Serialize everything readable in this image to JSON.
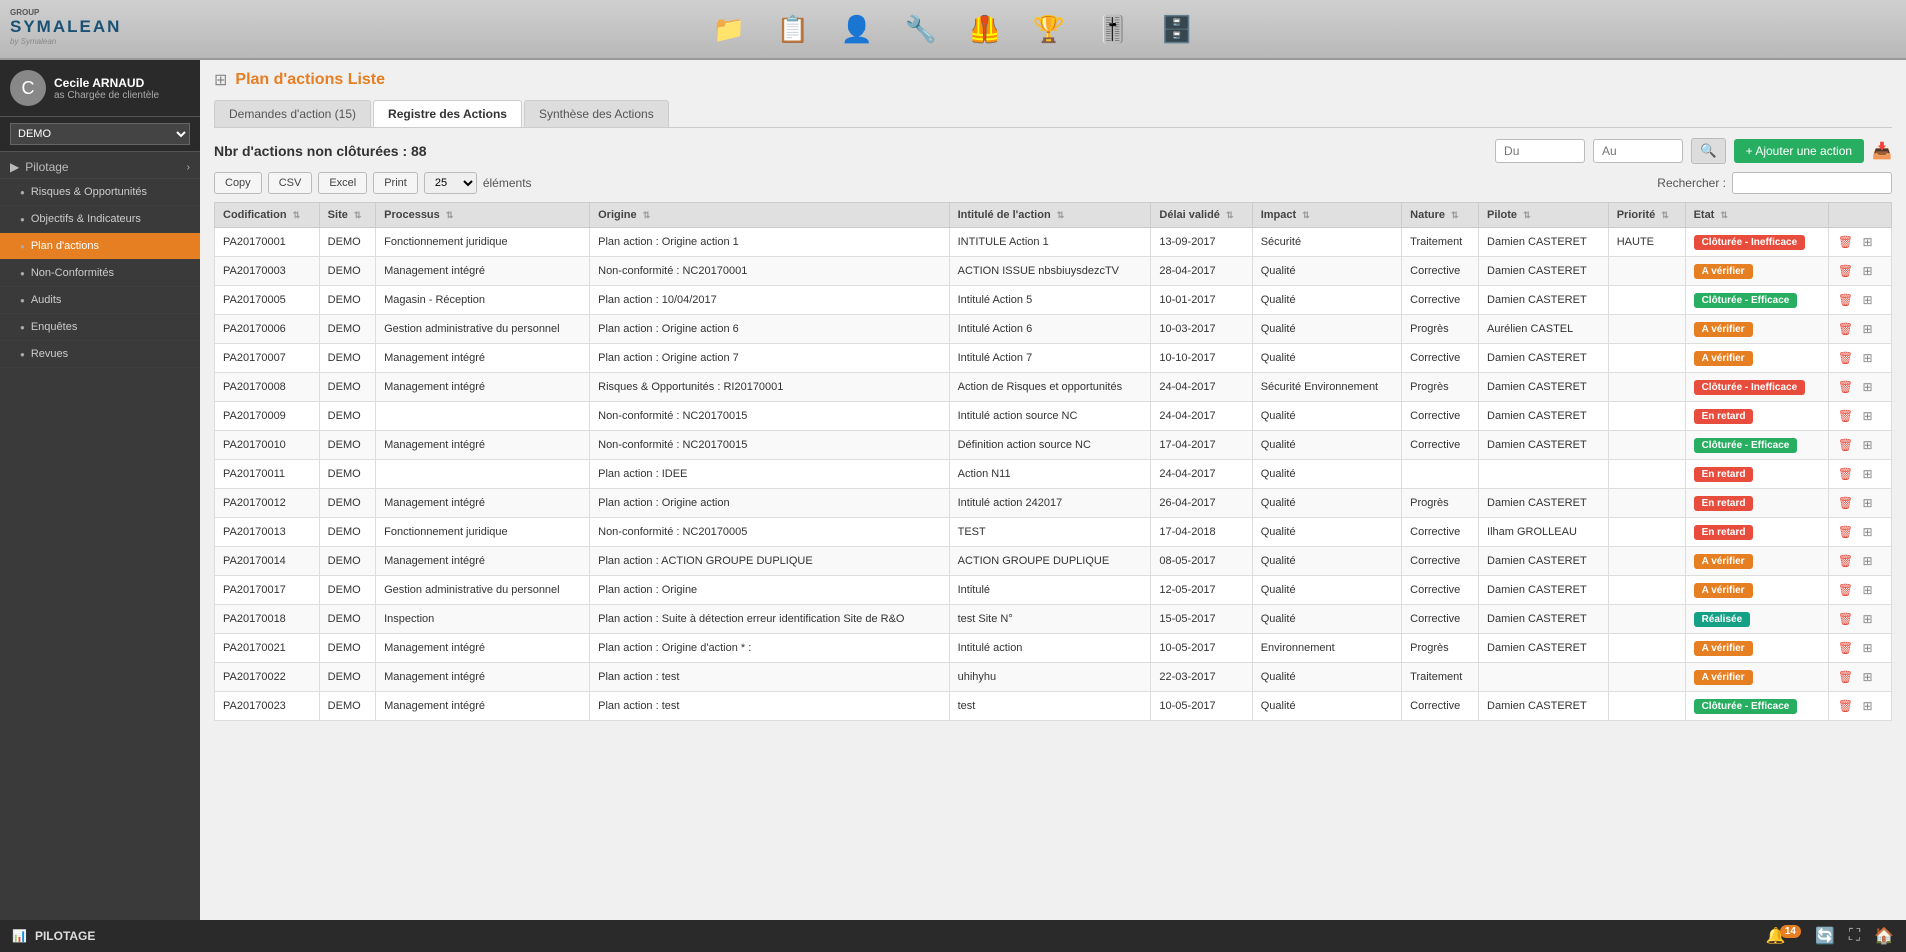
{
  "logo": {
    "main": "SYMALEAN",
    "group": "GROUP",
    "sub": "by Symalean"
  },
  "nav_icons": [
    "📁",
    "📋",
    "👤",
    "🔧",
    "🦺",
    "🏆",
    "🎚️",
    "🗄️"
  ],
  "user": {
    "name": "Cecile ARNAUD",
    "role": "as Chargée de clientèle",
    "avatar_initial": "C"
  },
  "demo_select": {
    "value": "DEMO",
    "options": [
      "DEMO"
    ]
  },
  "sidebar": {
    "sections": [
      {
        "label": "Pilotage",
        "active": false
      },
      {
        "label": "Risques & Opportunités",
        "active": false
      },
      {
        "label": "Objectifs & Indicateurs",
        "active": false
      },
      {
        "label": "Plan d'actions",
        "active": true
      },
      {
        "label": "Non-Conformités",
        "active": false
      },
      {
        "label": "Audits",
        "active": false
      },
      {
        "label": "Enquêtes",
        "active": false
      },
      {
        "label": "Revues",
        "active": false
      }
    ]
  },
  "page": {
    "title": "Plan d'actions",
    "subtitle": "Liste"
  },
  "tabs": [
    {
      "label": "Demandes d'action (15)",
      "active": false
    },
    {
      "label": "Registre des Actions",
      "active": true
    },
    {
      "label": "Synthèse des Actions",
      "active": false
    }
  ],
  "filter": {
    "count_label": "Nbr d'actions non clôturées : 88",
    "from_placeholder": "Du",
    "to_placeholder": "Au",
    "add_label": "+ Ajouter une action"
  },
  "toolbar": {
    "copy_label": "Copy",
    "csv_label": "CSV",
    "excel_label": "Excel",
    "print_label": "Print",
    "per_page": "25",
    "elements_label": "éléments",
    "search_label": "Rechercher :"
  },
  "table": {
    "columns": [
      "Codification",
      "Site",
      "Processus",
      "Origine",
      "Intitulé de l'action",
      "Délai validé",
      "Impact",
      "Nature",
      "Pilote",
      "Priorité",
      "Etat",
      ""
    ],
    "rows": [
      {
        "code": "PA20170001",
        "site": "DEMO",
        "processus": "Fonctionnement juridique",
        "origine": "Plan action : Origine action 1",
        "intitule": "INTITULE Action 1",
        "delai": "13-09-2017",
        "impact": "Sécurité",
        "nature": "Traitement",
        "pilote": "Damien CASTERET",
        "priorite": "HAUTE",
        "etat": "Clôturée - Inefficace",
        "etat_class": "badge-red"
      },
      {
        "code": "PA20170003",
        "site": "DEMO",
        "processus": "Management intégré",
        "origine": "Non-conformité : NC20170001",
        "intitule": "ACTION ISSUE nbsbiuysdezcTV",
        "delai": "28-04-2017",
        "impact": "Qualité",
        "nature": "Corrective",
        "pilote": "Damien CASTERET",
        "priorite": "",
        "etat": "A vérifier",
        "etat_class": "badge-orange"
      },
      {
        "code": "PA20170005",
        "site": "DEMO",
        "processus": "Magasin - Réception",
        "origine": "Plan action : 10/04/2017",
        "intitule": "Intitulé Action 5",
        "delai": "10-01-2017",
        "impact": "Qualité",
        "nature": "Corrective",
        "pilote": "Damien CASTERET",
        "priorite": "",
        "etat": "Clôturée - Efficace",
        "etat_class": "badge-green"
      },
      {
        "code": "PA20170006",
        "site": "DEMO",
        "processus": "Gestion administrative du personnel",
        "origine": "Plan action : Origine action 6",
        "intitule": "Intitulé Action 6",
        "delai": "10-03-2017",
        "impact": "Qualité",
        "nature": "Progrès",
        "pilote": "Aurélien CASTEL",
        "priorite": "",
        "etat": "A vérifier",
        "etat_class": "badge-orange"
      },
      {
        "code": "PA20170007",
        "site": "DEMO",
        "processus": "Management intégré",
        "origine": "Plan action : Origine action 7",
        "intitule": "Intitulé Action 7",
        "delai": "10-10-2017",
        "impact": "Qualité",
        "nature": "Corrective",
        "pilote": "Damien CASTERET",
        "priorite": "",
        "etat": "A vérifier",
        "etat_class": "badge-orange"
      },
      {
        "code": "PA20170008",
        "site": "DEMO",
        "processus": "Management intégré",
        "origine": "Risques & Opportunités : RI20170001",
        "intitule": "Action de Risques et opportunités",
        "delai": "24-04-2017",
        "impact": "Sécurité Environnement",
        "nature": "Progrès",
        "pilote": "Damien CASTERET",
        "priorite": "",
        "etat": "Clôturée - Inefficace",
        "etat_class": "badge-red"
      },
      {
        "code": "PA20170009",
        "site": "DEMO",
        "processus": "",
        "origine": "Non-conformité : NC20170015",
        "intitule": "Intitulé action source NC",
        "delai": "24-04-2017",
        "impact": "Qualité",
        "nature": "Corrective",
        "pilote": "Damien CASTERET",
        "priorite": "",
        "etat": "En retard",
        "etat_class": "badge-red"
      },
      {
        "code": "PA20170010",
        "site": "DEMO",
        "processus": "Management intégré",
        "origine": "Non-conformité : NC20170015",
        "intitule": "Définition action source NC",
        "delai": "17-04-2017",
        "impact": "Qualité",
        "nature": "Corrective",
        "pilote": "Damien CASTERET",
        "priorite": "",
        "etat": "Clôturée - Efficace",
        "etat_class": "badge-green"
      },
      {
        "code": "PA20170011",
        "site": "DEMO",
        "processus": "",
        "origine": "Plan action : IDEE",
        "intitule": "Action N11",
        "delai": "24-04-2017",
        "impact": "Qualité",
        "nature": "",
        "pilote": "",
        "priorite": "",
        "etat": "En retard",
        "etat_class": "badge-red"
      },
      {
        "code": "PA20170012",
        "site": "DEMO",
        "processus": "Management intégré",
        "origine": "Plan action : Origine action",
        "intitule": "Intitulé action 242017",
        "delai": "26-04-2017",
        "impact": "Qualité",
        "nature": "Progrès",
        "pilote": "Damien CASTERET",
        "priorite": "",
        "etat": "En retard",
        "etat_class": "badge-red"
      },
      {
        "code": "PA20170013",
        "site": "DEMO",
        "processus": "Fonctionnement juridique",
        "origine": "Non-conformité : NC20170005",
        "intitule": "TEST",
        "delai": "17-04-2018",
        "impact": "Qualité",
        "nature": "Corrective",
        "pilote": "Ilham GROLLEAU",
        "priorite": "",
        "etat": "En retard",
        "etat_class": "badge-red"
      },
      {
        "code": "PA20170014",
        "site": "DEMO",
        "processus": "Management intégré",
        "origine": "Plan action : ACTION GROUPE DUPLIQUE",
        "intitule": "ACTION GROUPE DUPLIQUE",
        "delai": "08-05-2017",
        "impact": "Qualité",
        "nature": "Corrective",
        "pilote": "Damien CASTERET",
        "priorite": "",
        "etat": "A vérifier",
        "etat_class": "badge-orange"
      },
      {
        "code": "PA20170017",
        "site": "DEMO",
        "processus": "Gestion administrative du personnel",
        "origine": "Plan action : Origine",
        "intitule": "Intitulé",
        "delai": "12-05-2017",
        "impact": "Qualité",
        "nature": "Corrective",
        "pilote": "Damien CASTERET",
        "priorite": "",
        "etat": "A vérifier",
        "etat_class": "badge-orange"
      },
      {
        "code": "PA20170018",
        "site": "DEMO",
        "processus": "Inspection",
        "origine": "Plan action : Suite à détection erreur identification Site de R&O",
        "intitule": "test Site N°",
        "delai": "15-05-2017",
        "impact": "Qualité",
        "nature": "Corrective",
        "pilote": "Damien CASTERET",
        "priorite": "",
        "etat": "Réalisée",
        "etat_class": "badge-teal"
      },
      {
        "code": "PA20170021",
        "site": "DEMO",
        "processus": "Management intégré",
        "origine": "Plan action : Origine d'action * :",
        "intitule": "Intitulé action",
        "delai": "10-05-2017",
        "impact": "Environnement",
        "nature": "Progrès",
        "pilote": "Damien CASTERET",
        "priorite": "",
        "etat": "A vérifier",
        "etat_class": "badge-orange"
      },
      {
        "code": "PA20170022",
        "site": "DEMO",
        "processus": "Management intégré",
        "origine": "Plan action : test",
        "intitule": "uhihyhu",
        "delai": "22-03-2017",
        "impact": "Qualité",
        "nature": "Traitement",
        "pilote": "",
        "priorite": "",
        "etat": "A vérifier",
        "etat_class": "badge-orange"
      },
      {
        "code": "PA20170023",
        "site": "DEMO",
        "processus": "Management intégré",
        "origine": "Plan action : test",
        "intitule": "test",
        "delai": "10-05-2017",
        "impact": "Qualité",
        "nature": "Corrective",
        "pilote": "Damien CASTERET",
        "priorite": "",
        "etat": "Clôturée - Efficace",
        "etat_class": "badge-green"
      }
    ]
  },
  "bottom_bar": {
    "label": "PILOTAGE",
    "notif_count": "14"
  }
}
